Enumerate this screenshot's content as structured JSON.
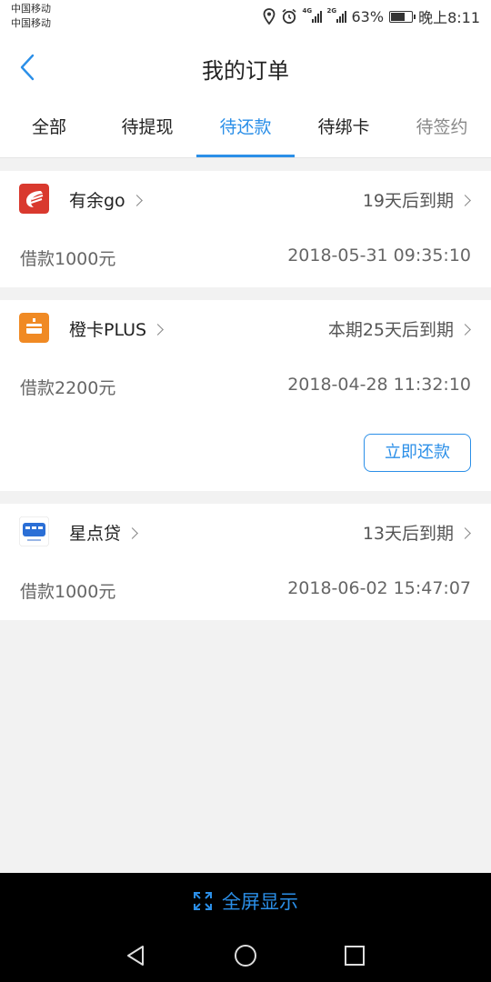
{
  "status_bar": {
    "carrier1": "中国移动",
    "carrier2": "中国移动",
    "net1": "4G",
    "net2": "2G",
    "battery": "63%",
    "battery_level": 0.63,
    "time": "晚上8:11"
  },
  "header": {
    "title": "我的订单"
  },
  "tabs": [
    {
      "label": "全部"
    },
    {
      "label": "待提现"
    },
    {
      "label": "待还款"
    },
    {
      "label": "待绑卡"
    },
    {
      "label": "待签约"
    }
  ],
  "active_tab": "待还款",
  "orders": [
    {
      "app": "有余go",
      "due": "19天后到期",
      "loan": "借款1000元",
      "datetime": "2018-05-31 09:35:10"
    },
    {
      "app": "橙卡PLUS",
      "due": "本期25天后到期",
      "loan": "借款2200元",
      "datetime": "2018-04-28 11:32:10",
      "action": "立即还款"
    },
    {
      "app": "星点贷",
      "due": "13天后到期",
      "loan": "借款1000元",
      "datetime": "2018-06-02 15:47:07"
    }
  ],
  "footer": {
    "fullscreen_label": "全屏显示"
  },
  "colors": {
    "accent": "#2b8fe8",
    "youyu_icon": "#d9392e",
    "chengka_icon": "#f08a24",
    "background": "#f2f2f2"
  }
}
